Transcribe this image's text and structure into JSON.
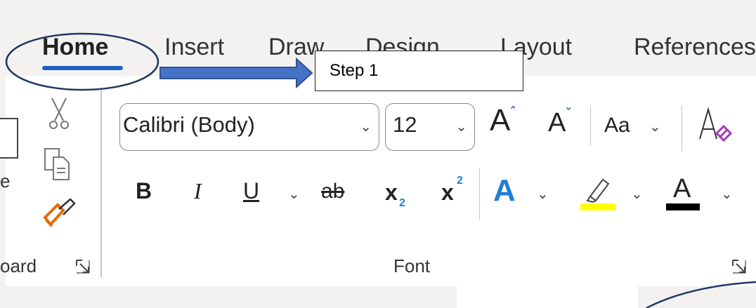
{
  "tabs": [
    {
      "label": "Home",
      "active": true
    },
    {
      "label": "Insert"
    },
    {
      "label": "Draw"
    },
    {
      "label": "Design"
    },
    {
      "label": "Layout"
    },
    {
      "label": "References"
    }
  ],
  "clipboard": {
    "partial_label_left": "e",
    "group_label": "oard"
  },
  "font": {
    "font_name": "Calibri (Body)",
    "font_size": "12",
    "grow_font": "A",
    "shrink_font": "A",
    "change_case": "Aa",
    "bold": "B",
    "italic": "I",
    "underline": "U",
    "strikethrough": "ab",
    "subscript": "x",
    "subscript_mark": "2",
    "superscript": "x",
    "superscript_mark": "2",
    "text_effects": "A",
    "font_color": "A",
    "group_label": "Font",
    "highlight_color": "#ffff00",
    "font_color_bar": "#000000"
  },
  "annotation": {
    "callout_text": "Step 1",
    "arrow_color": "#4472c4",
    "circle_color": "#1f3864"
  }
}
